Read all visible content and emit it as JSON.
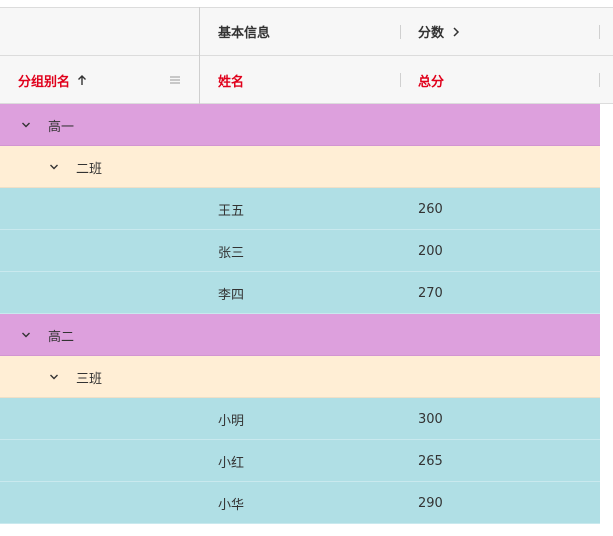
{
  "header": {
    "group_header_basic": "基本信息",
    "group_header_scores": "分数",
    "autogroup_column": "分组别名",
    "name_column": "姓名",
    "total_column": "总分"
  },
  "rows": [
    {
      "type": "group1",
      "label": "高一"
    },
    {
      "type": "group2",
      "label": "二班"
    },
    {
      "type": "leaf",
      "name": "王五",
      "total": "260"
    },
    {
      "type": "leaf",
      "name": "张三",
      "total": "200"
    },
    {
      "type": "leaf",
      "name": "李四",
      "total": "270"
    },
    {
      "type": "group1",
      "label": "高二"
    },
    {
      "type": "group2",
      "label": "三班"
    },
    {
      "type": "leaf",
      "name": "小明",
      "total": "300"
    },
    {
      "type": "leaf",
      "name": "小红",
      "total": "265"
    },
    {
      "type": "leaf",
      "name": "小华",
      "total": "290"
    }
  ],
  "colors": {
    "group1_bg": "#dda0dd",
    "group2_bg": "#ffeed5",
    "leaf_bg": "#b0dfe5",
    "header_text_accent": "#e0001b"
  }
}
